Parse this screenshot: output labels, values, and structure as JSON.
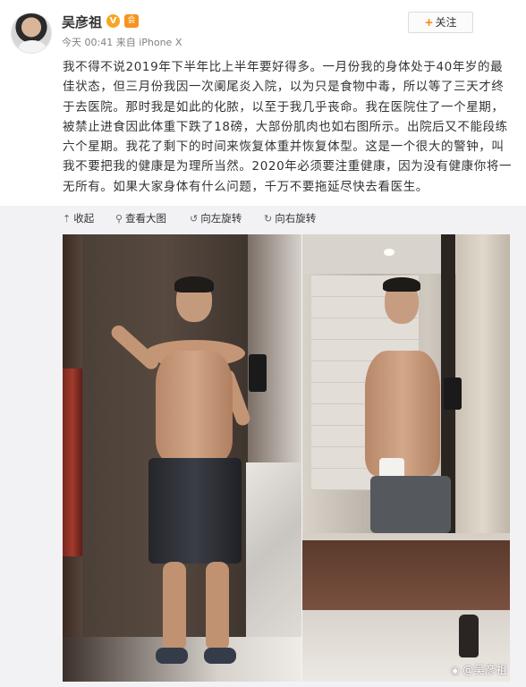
{
  "post": {
    "username": "吴彦祖",
    "verify_badge": "V",
    "member_badge": "会",
    "meta": "今天 00:41 来自 iPhone X",
    "follow_label": "关注",
    "text": "我不得不说2019年下半年比上半年要好得多。一月份我的身体处于40年岁的最佳状态，但三月份我因一次阑尾炎入院，以为只是食物中毒，所以等了三天才终于去医院。那时我是如此的化脓，以至于我几乎丧命。我在医院住了一个星期，被禁止进食因此体重下跌了18磅，大部份肌肉也如右图所示。出院后又不能段练六个星期。我花了剩下的时间来恢复体重并恢复体型。这是一个很大的警钟，叫我不要把我的健康是为理所当然。2020年必须要注重健康，因为没有健康你将一无所有。如果大家身体有什么问题，千万不要拖延尽快去看医生。"
  },
  "toolbar": {
    "collapse_label": "收起",
    "view_large_label": "查看大图",
    "rotate_left_label": "向左旋转",
    "rotate_right_label": "向右旋转"
  },
  "watermark": {
    "text": "@吴彦祖"
  },
  "colors": {
    "accent": "#ff8200",
    "toolbar_bg": "#f2f2f5"
  }
}
